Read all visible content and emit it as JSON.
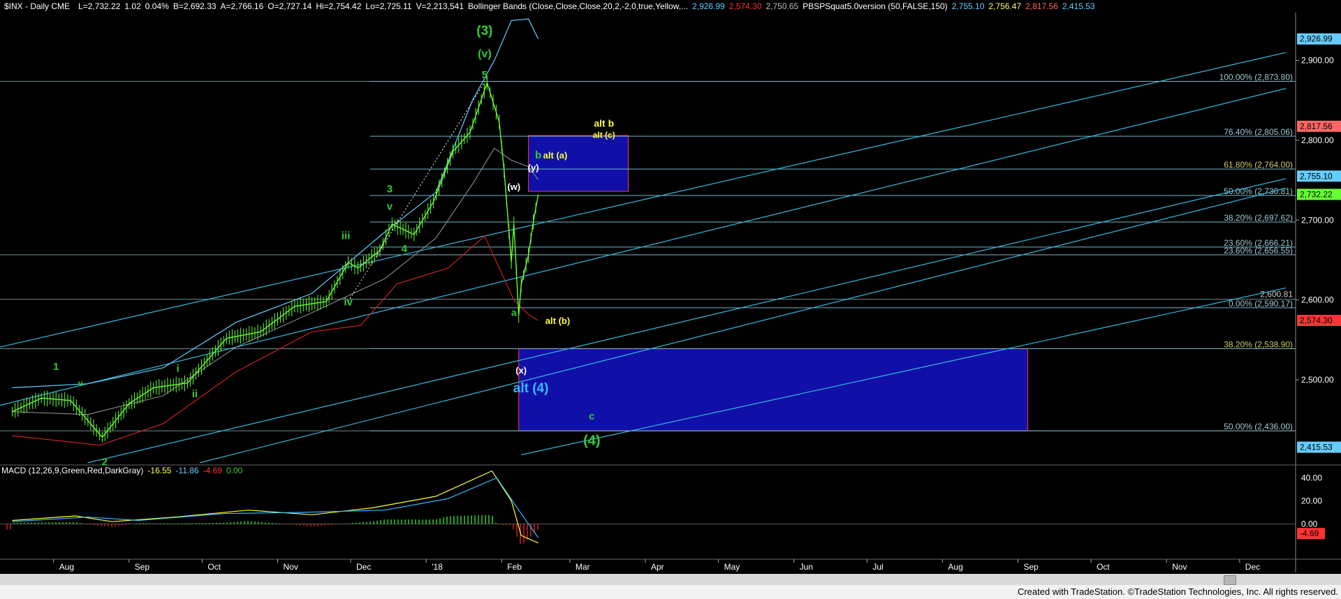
{
  "header": {
    "symbol": "$INX - Daily  CME",
    "items": [
      {
        "text": "L=2,732.22",
        "color": "#ffffff"
      },
      {
        "text": "1.02",
        "color": "#ffffff"
      },
      {
        "text": "0.04%",
        "color": "#ffffff"
      },
      {
        "text": "B=2,692.33",
        "color": "#ffffff"
      },
      {
        "text": "A=2,766.16",
        "color": "#ffffff"
      },
      {
        "text": "O=2,727.14",
        "color": "#ffffff"
      },
      {
        "text": "Hi=2,754.42",
        "color": "#ffffff"
      },
      {
        "text": "Lo=2,725.11",
        "color": "#ffffff"
      },
      {
        "text": "V=2,213,541",
        "color": "#ffffff"
      },
      {
        "text": "Bollinger Bands (Close,Close,Close,20,2,-2,0,true,Yellow,...",
        "color": "#ffffff"
      },
      {
        "text": "2,926.99",
        "color": "#66ccff"
      },
      {
        "text": "2,574.30",
        "color": "#ff3333"
      },
      {
        "text": "2,750.65",
        "color": "#bbbbbb"
      },
      {
        "text": "PBSPSquat5.0version (50,FALSE,150)",
        "color": "#ffffff"
      },
      {
        "text": "2,755.10",
        "color": "#66ccff"
      },
      {
        "text": "2,756.47",
        "color": "#ffff66"
      },
      {
        "text": "2,817.56",
        "color": "#ff6666"
      },
      {
        "text": "2,415.53",
        "color": "#66ccff"
      }
    ]
  },
  "macd_header": {
    "items": [
      {
        "text": "MACD (12,26,9,Green,Red,DarkGray)",
        "color": "#ffffff"
      },
      {
        "text": "-16.55",
        "color": "#ffff66"
      },
      {
        "text": "-11.86",
        "color": "#66ccff"
      },
      {
        "text": "-4.69",
        "color": "#ff3333"
      },
      {
        "text": "0.00",
        "color": "#33cc33"
      }
    ]
  },
  "footer": {
    "text": "Created with TradeStation. ©TradeStation Technologies, Inc. All rights reserved."
  },
  "colors": {
    "price": "#66ff33",
    "upper_band": "#66ccff",
    "lower_band": "#cc2222",
    "mid_band": "#999999",
    "channel": "#33bbdd",
    "fib": "#6fb7c7",
    "box": "#1010a8",
    "box_border": "#ff3355",
    "wave_green": "#33cc33",
    "wave_yellow": "#ffff33",
    "wave_white": "#ffffff",
    "wave_cyan": "#33bbff"
  },
  "chart_data": {
    "type": "line",
    "title": "$INX - Daily",
    "ylim": [
      2395,
      2960
    ],
    "x_ticks": [
      "Aug",
      "Aug",
      "Sep",
      "Oct",
      "Nov",
      "Dec",
      "'18",
      "Feb",
      "Mar",
      "Apr",
      "May",
      "Jun",
      "Jul",
      "Aug",
      "Sep",
      "Oct",
      "Nov",
      "Dec"
    ],
    "y_ticks": [
      "2,900.00",
      "2,800.00",
      "2,700.00",
      "2,600.00",
      "2,500.00"
    ],
    "price_series": [
      {
        "date": "2017-07-15",
        "value": 2460
      },
      {
        "date": "2017-07-27",
        "value": 2477
      },
      {
        "date": "2017-08-08",
        "value": 2474
      },
      {
        "date": "2017-08-21",
        "value": 2428
      },
      {
        "date": "2017-09-01",
        "value": 2470
      },
      {
        "date": "2017-09-11",
        "value": 2490
      },
      {
        "date": "2017-09-25",
        "value": 2496
      },
      {
        "date": "2017-10-11",
        "value": 2552
      },
      {
        "date": "2017-10-25",
        "value": 2560
      },
      {
        "date": "2017-11-08",
        "value": 2592
      },
      {
        "date": "2017-11-21",
        "value": 2598
      },
      {
        "date": "2017-11-30",
        "value": 2647
      },
      {
        "date": "2017-12-04",
        "value": 2640
      },
      {
        "date": "2017-12-13",
        "value": 2662
      },
      {
        "date": "2017-12-18",
        "value": 2695
      },
      {
        "date": "2017-12-27",
        "value": 2682
      },
      {
        "date": "2018-01-04",
        "value": 2723
      },
      {
        "date": "2018-01-12",
        "value": 2786
      },
      {
        "date": "2018-01-19",
        "value": 2810
      },
      {
        "date": "2018-01-26",
        "value": 2872
      },
      {
        "date": "2018-01-31",
        "value": 2823
      },
      {
        "date": "2018-02-02",
        "value": 2762
      },
      {
        "date": "2018-02-05",
        "value": 2648
      },
      {
        "date": "2018-02-06",
        "value": 2695
      },
      {
        "date": "2018-02-08",
        "value": 2581
      },
      {
        "date": "2018-02-09",
        "value": 2619
      },
      {
        "date": "2018-02-12",
        "value": 2656
      },
      {
        "date": "2018-02-14",
        "value": 2698
      },
      {
        "date": "2018-02-16",
        "value": 2732
      }
    ],
    "upper_band": [
      {
        "date": "2017-07-15",
        "value": 2490
      },
      {
        "date": "2017-08-15",
        "value": 2495
      },
      {
        "date": "2017-09-15",
        "value": 2515
      },
      {
        "date": "2017-10-15",
        "value": 2572
      },
      {
        "date": "2017-11-15",
        "value": 2608
      },
      {
        "date": "2017-12-15",
        "value": 2685
      },
      {
        "date": "2018-01-05",
        "value": 2735
      },
      {
        "date": "2018-01-20",
        "value": 2850
      },
      {
        "date": "2018-01-29",
        "value": 2900
      },
      {
        "date": "2018-02-05",
        "value": 2950
      },
      {
        "date": "2018-02-12",
        "value": 2952
      },
      {
        "date": "2018-02-16",
        "value": 2927
      }
    ],
    "lower_band": [
      {
        "date": "2017-07-15",
        "value": 2430
      },
      {
        "date": "2017-08-20",
        "value": 2418
      },
      {
        "date": "2017-09-15",
        "value": 2445
      },
      {
        "date": "2017-10-15",
        "value": 2510
      },
      {
        "date": "2017-11-15",
        "value": 2560
      },
      {
        "date": "2017-12-05",
        "value": 2568
      },
      {
        "date": "2017-12-20",
        "value": 2620
      },
      {
        "date": "2018-01-10",
        "value": 2640
      },
      {
        "date": "2018-01-25",
        "value": 2680
      },
      {
        "date": "2018-02-06",
        "value": 2600
      },
      {
        "date": "2018-02-12",
        "value": 2582
      },
      {
        "date": "2018-02-16",
        "value": 2574
      }
    ],
    "fib_levels": [
      {
        "label": "100.00% (2,873.80)",
        "value": 2873.8
      },
      {
        "label": "76.40% (2,805.06)",
        "value": 2805.06
      },
      {
        "label": "61.80% (2,764.00)",
        "value": 2764.0
      },
      {
        "label": "50.00% (2,730.81)",
        "value": 2730.81
      },
      {
        "label": "38.20% (2,697.62)",
        "value": 2697.62
      },
      {
        "label": "23.60% (2,666.21)",
        "value": 2666.21
      },
      {
        "label": "23.60% (2,656.55)",
        "value": 2656.55
      },
      {
        "label": "0.00% (2,590.17)",
        "value": 2590.17
      },
      {
        "label": "38.20% (2,538.90)",
        "value": 2538.9
      },
      {
        "label": "50.00% (2,436.00)",
        "value": 2436.0
      }
    ],
    "horizontal_labels": [
      {
        "label": "2,600.81",
        "value": 2600.81
      }
    ],
    "price_axis_tags": [
      {
        "text": "2,926.99",
        "value": 2926.99,
        "color": "#66ccff"
      },
      {
        "text": "2,817.56",
        "value": 2817.56,
        "color": "#ff6666"
      },
      {
        "text": "2,755.10",
        "value": 2755.1,
        "color": "#66ccff"
      },
      {
        "text": "2,732.22",
        "value": 2732.22,
        "color": "#66ff33"
      },
      {
        "text": "2,574.30",
        "value": 2574.3,
        "color": "#ff3333"
      },
      {
        "text": "2,415.53",
        "value": 2415.53,
        "color": "#66ccff"
      }
    ],
    "channels": [
      {
        "from": {
          "date": "2017-07-10",
          "value": 2541
        },
        "to": {
          "date": "2018-12-20",
          "value": 2910
        }
      },
      {
        "from": {
          "date": "2017-07-10",
          "value": 2468
        },
        "to": {
          "date": "2018-12-20",
          "value": 2865
        }
      },
      {
        "from": {
          "date": "2017-08-15",
          "value": 2396
        },
        "to": {
          "date": "2018-12-20",
          "value": 2752
        }
      },
      {
        "from": {
          "date": "2017-09-30",
          "value": 2396
        },
        "to": {
          "date": "2018-12-20",
          "value": 2740
        }
      },
      {
        "from": {
          "date": "2018-02-09",
          "value": 2406
        },
        "to": {
          "date": "2018-12-20",
          "value": 2615
        }
      }
    ],
    "boxes": [
      {
        "x0": "2018-02-12",
        "x1": "2018-03-25",
        "y0": 2736,
        "y1": 2806
      },
      {
        "x0": "2018-02-08",
        "x1": "2018-09-05",
        "y0": 2436,
        "y1": 2539
      }
    ],
    "wave_labels": [
      {
        "text": "(3)",
        "date": "2018-01-25",
        "value": 2932,
        "color": "#33cc33",
        "size": 19
      },
      {
        "text": "(v)",
        "date": "2018-01-25",
        "value": 2904,
        "color": "#33cc33",
        "size": 16
      },
      {
        "text": "5",
        "date": "2018-01-25",
        "value": 2878,
        "color": "#33cc33",
        "size": 15
      },
      {
        "text": "3",
        "date": "2017-12-17",
        "value": 2735,
        "color": "#33cc33",
        "size": 15
      },
      {
        "text": "v",
        "date": "2017-12-17",
        "value": 2713,
        "color": "#33cc33",
        "size": 15
      },
      {
        "text": "iii",
        "date": "2017-11-29",
        "value": 2676,
        "color": "#33cc33",
        "size": 15
      },
      {
        "text": "4",
        "date": "2017-12-23",
        "value": 2660,
        "color": "#33cc33",
        "size": 15
      },
      {
        "text": "iv",
        "date": "2017-11-30",
        "value": 2593,
        "color": "#33cc33",
        "size": 15
      },
      {
        "text": "i",
        "date": "2017-09-21",
        "value": 2510,
        "color": "#33cc33",
        "size": 15
      },
      {
        "text": "ii",
        "date": "2017-09-28",
        "value": 2478,
        "color": "#33cc33",
        "size": 15
      },
      {
        "text": "1",
        "date": "2017-08-02",
        "value": 2512,
        "color": "#33cc33",
        "size": 15
      },
      {
        "text": "v",
        "date": "2017-08-12",
        "value": 2492,
        "color": "#33cc33",
        "size": 12
      },
      {
        "text": "2",
        "date": "2017-08-22",
        "value": 2393,
        "color": "#33cc33",
        "size": 15
      },
      {
        "text": "a",
        "date": "2018-02-06",
        "value": 2580,
        "color": "#33cc33",
        "size": 14
      },
      {
        "text": "b",
        "date": "2018-02-16",
        "value": 2777,
        "color": "#33cc33",
        "size": 15
      },
      {
        "text": "c",
        "date": "2018-03-10",
        "value": 2450,
        "color": "#33cc33",
        "size": 15
      },
      {
        "text": "(4)",
        "date": "2018-03-10",
        "value": 2418,
        "color": "#33cc33",
        "size": 20
      },
      {
        "text": "alt (a)",
        "date": "2018-02-23",
        "value": 2777,
        "color": "#ffff33",
        "size": 13
      },
      {
        "text": "alt b",
        "date": "2018-03-15",
        "value": 2817,
        "color": "#ffff33",
        "size": 14
      },
      {
        "text": "alt (c)",
        "date": "2018-03-15",
        "value": 2803,
        "color": "#ffff33",
        "size": 12
      },
      {
        "text": "alt (b)",
        "date": "2018-02-24",
        "value": 2570,
        "color": "#ffff33",
        "size": 13
      },
      {
        "text": "(y)",
        "date": "2018-02-14",
        "value": 2762,
        "color": "#ffffff",
        "size": 13
      },
      {
        "text": "(w)",
        "date": "2018-02-06",
        "value": 2738,
        "color": "#ffffff",
        "size": 13
      },
      {
        "text": "(x)",
        "date": "2018-02-09",
        "value": 2508,
        "color": "#ffffff",
        "size": 13
      },
      {
        "text": "alt (4)",
        "date": "2018-02-13",
        "value": 2484,
        "color": "#33bbff",
        "size": 19
      }
    ],
    "macd": {
      "ylim": [
        -30,
        50
      ],
      "y_ticks": [
        "40.00",
        "20.00",
        "0.00"
      ],
      "tags": [
        {
          "text": "-4.69",
          "value": -4.69,
          "color": "#ff3333"
        }
      ],
      "macd_line": [
        {
          "date": "2017-07-15",
          "value": 3
        },
        {
          "date": "2017-08-10",
          "value": 7
        },
        {
          "date": "2017-08-25",
          "value": 2
        },
        {
          "date": "2017-09-20",
          "value": 6
        },
        {
          "date": "2017-10-20",
          "value": 12
        },
        {
          "date": "2017-11-15",
          "value": 8
        },
        {
          "date": "2017-12-10",
          "value": 14
        },
        {
          "date": "2018-01-05",
          "value": 24
        },
        {
          "date": "2018-01-28",
          "value": 46
        },
        {
          "date": "2018-02-05",
          "value": 20
        },
        {
          "date": "2018-02-09",
          "value": -10
        },
        {
          "date": "2018-02-16",
          "value": -16.55
        }
      ],
      "signal_line": [
        {
          "date": "2017-07-15",
          "value": 2
        },
        {
          "date": "2017-08-15",
          "value": 6
        },
        {
          "date": "2017-09-05",
          "value": 3
        },
        {
          "date": "2017-10-10",
          "value": 9
        },
        {
          "date": "2017-11-10",
          "value": 10
        },
        {
          "date": "2017-12-15",
          "value": 12
        },
        {
          "date": "2018-01-10",
          "value": 22
        },
        {
          "date": "2018-01-30",
          "value": 40
        },
        {
          "date": "2018-02-08",
          "value": 12
        },
        {
          "date": "2018-02-16",
          "value": -11.86
        }
      ],
      "histogram_note_values": [
        -4.69
      ]
    }
  }
}
